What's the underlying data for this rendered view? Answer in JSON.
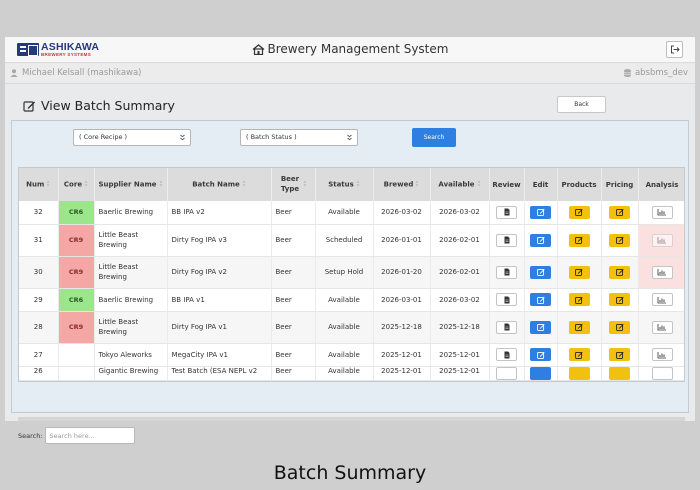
{
  "header": {
    "logo_name": "ASHIKAWA",
    "logo_sub": "BREWERY SYSTEMS",
    "app_title": "Brewery Management System"
  },
  "subbar": {
    "user": "Michael Kelsall (mashikawa)",
    "db": "absbms_dev"
  },
  "page": {
    "title": "View Batch Summary",
    "back_label": "Back"
  },
  "filters": {
    "core_recipe": "( Core Recipe )",
    "batch_status": "( Batch Status )",
    "search_label": "Search"
  },
  "table": {
    "columns": [
      "Num",
      "Core",
      "Supplier Name",
      "Batch Name",
      "Beer Type",
      "Status",
      "Brewed",
      "Available",
      "Review",
      "Edit",
      "Products",
      "Pricing",
      "Analysis"
    ],
    "rows": [
      {
        "num": "32",
        "core": "CR6",
        "supplier": "Baerlic Brewing",
        "batch": "BB IPA v2",
        "type": "Beer",
        "status": "Available",
        "brewed": "2026-03-02",
        "available": "2026-03-02"
      },
      {
        "num": "31",
        "core": "CR9",
        "supplier": "Little Beast Brewing",
        "batch": "Dirty Fog IPA v3",
        "type": "Beer",
        "status": "Scheduled",
        "brewed": "2026-01-01",
        "available": "2026-02-01"
      },
      {
        "num": "30",
        "core": "CR9",
        "supplier": "Little Beast Brewing",
        "batch": "Dirty Fog IPA v2",
        "type": "Beer",
        "status": "Setup Hold",
        "brewed": "2026-01-20",
        "available": "2026-02-01"
      },
      {
        "num": "29",
        "core": "CR6",
        "supplier": "Baerlic Brewing",
        "batch": "BB IPA v1",
        "type": "Beer",
        "status": "Available",
        "brewed": "2026-03-01",
        "available": "2026-03-02"
      },
      {
        "num": "28",
        "core": "CR9",
        "supplier": "Little Beast Brewing",
        "batch": "Dirty Fog IPA v1",
        "type": "Beer",
        "status": "Available",
        "brewed": "2025-12-18",
        "available": "2025-12-18"
      },
      {
        "num": "27",
        "core": "",
        "supplier": "Tokyo Aleworks",
        "batch": "MegaCity IPA v1",
        "type": "Beer",
        "status": "Available",
        "brewed": "2025-12-01",
        "available": "2025-12-01"
      },
      {
        "num": "26",
        "core": "",
        "supplier": "Gigantic Brewing",
        "batch": "Test Batch (ESA NEPL v2",
        "type": "Beer",
        "status": "Available",
        "brewed": "2025-12-01",
        "available": "2025-12-01"
      }
    ]
  },
  "footer": {
    "search_label": "Search:",
    "search_placeholder": "Search here..."
  },
  "caption": "Batch Summary",
  "colors": {
    "primary_blue": "#2f7fe2",
    "pricing_yellow": "#f2c10f",
    "cr6_green": "#9be58b",
    "cr9_red": "#f4a7a5",
    "logo_navy": "#243a7a"
  }
}
